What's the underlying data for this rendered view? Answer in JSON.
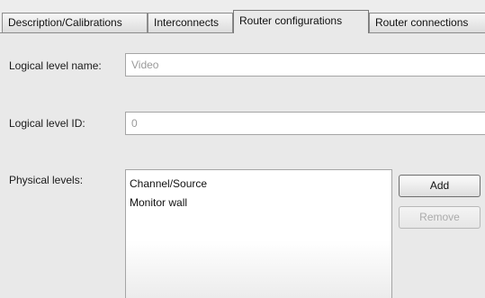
{
  "tabs": [
    {
      "label": "Description/Calibrations",
      "active": false
    },
    {
      "label": "Interconnects",
      "active": false
    },
    {
      "label": "Router configurations",
      "active": true
    },
    {
      "label": "Router connections",
      "active": false
    }
  ],
  "form": {
    "logical_level_name_label": "Logical level name:",
    "logical_level_name_value": "Video",
    "logical_level_id_label": "Logical level ID:",
    "logical_level_id_value": "0",
    "physical_levels_label": "Physical levels:",
    "physical_levels": [
      "Channel/Source",
      "Monitor wall"
    ]
  },
  "buttons": {
    "add_label": "Add",
    "remove_label": "Remove",
    "remove_enabled": false
  }
}
